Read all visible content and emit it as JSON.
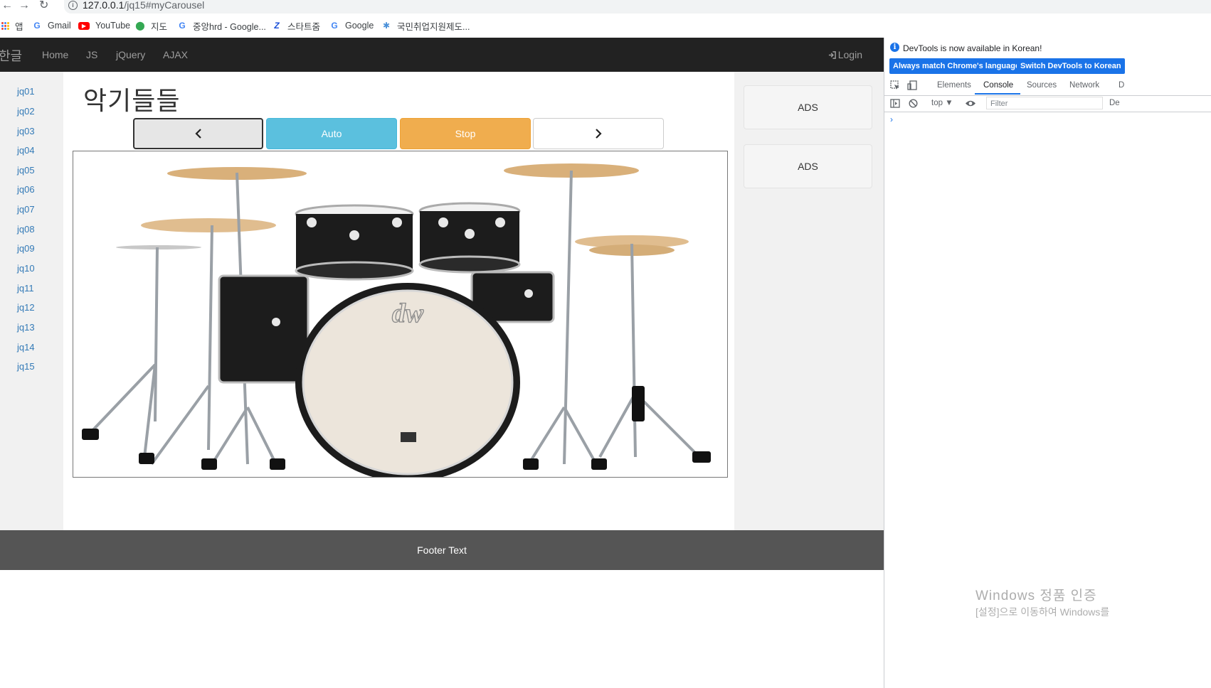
{
  "browser": {
    "url_main": "127.0.0.1",
    "url_rest": "/jq15#myCarousel",
    "bookmarks": [
      {
        "label": "앱",
        "icon": "apps-grid-icon"
      },
      {
        "label": "Gmail",
        "icon": "google-icon"
      },
      {
        "label": "YouTube",
        "icon": "youtube-icon"
      },
      {
        "label": "지도",
        "icon": "maps-pin-icon"
      },
      {
        "label": "중앙hrd - Google...",
        "icon": "google-icon"
      },
      {
        "label": "스타트줌",
        "icon": "z-logo-icon"
      },
      {
        "label": "Google",
        "icon": "google-icon"
      },
      {
        "label": "국민취업지원제도...",
        "icon": "hrd-icon"
      }
    ]
  },
  "navbar": {
    "brand": "한글",
    "links": [
      "Home",
      "JS",
      "jQuery",
      "AJAX"
    ],
    "login": "Login"
  },
  "sidenav": {
    "links": [
      "jq01",
      "jq02",
      "jq03",
      "jq04",
      "jq05",
      "jq06",
      "jq07",
      "jq08",
      "jq09",
      "jq10",
      "jq11",
      "jq12",
      "jq13",
      "jq14",
      "jq15"
    ]
  },
  "main": {
    "title": "악기들들",
    "buttons": {
      "prev": "<",
      "auto": "Auto",
      "stop": "Stop",
      "next": ">"
    },
    "image_alt": "drum kit",
    "drum_logo": "dw"
  },
  "ads": [
    "ADS",
    "ADS"
  ],
  "footer": "Footer Text",
  "devtools": {
    "info_message": "DevTools is now available in Korean!",
    "btn_match": "Always match Chrome's language",
    "btn_switch": "Switch DevTools to Korean",
    "tabs": [
      "Elements",
      "Console",
      "Sources",
      "Network",
      "D"
    ],
    "active_tab": "Console",
    "context": "top",
    "filter_placeholder": "Filter",
    "right_cut": "De",
    "prompt": "›"
  },
  "watermark": {
    "line1": "Windows 정품 인증",
    "line2": "[설정]으로 이동하여 Windows를"
  }
}
